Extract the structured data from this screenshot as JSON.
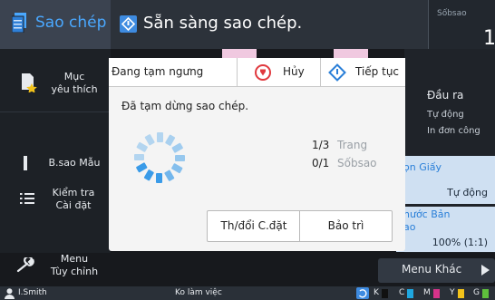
{
  "header": {
    "app_label": "Sao chép",
    "status": "Sẵn sàng sao chép.",
    "copies_caption": "Sốbsao",
    "copies_value": "1"
  },
  "menu": {
    "items": [
      {
        "label": "Mục\nyêu thích",
        "icon": "favorite-doc-icon"
      },
      {
        "label": "B.sao Mẫu",
        "icon": "sample-copy-icon"
      },
      {
        "label": "Kiểm tra\nCài đặt",
        "icon": "list-icon"
      },
      {
        "label": "Menu\nTùy chỉnh",
        "icon": "wrench-icon"
      }
    ]
  },
  "right_panel": {
    "title": "Đầu ra",
    "sub1": "Tự động",
    "sub2": "In đơn công",
    "paper_title": "ọn Giấy",
    "paper_value": "Tự động",
    "size_title": "hước Bản\nao",
    "size_value": "100% (1:1)"
  },
  "menu_khac": "Menu Khác",
  "status_bar": {
    "user": "I.Smith",
    "state": "Ko làm việc",
    "inks": [
      "K",
      "C",
      "M",
      "Y",
      "G"
    ]
  },
  "dialog": {
    "title": "Đang tạm ngưng",
    "cancel_label": "Hủy",
    "resume_label": "Tiếp tục",
    "message": "Đã tạm dừng sao chép.",
    "page_count": "1/3",
    "page_label": "Trang",
    "copy_count": "0/1",
    "copy_label": "Sốbsao",
    "change_label": "Th/đổi C.đặt",
    "maintenance_label": "Bảo trì"
  },
  "colors": {
    "accent": "#2a7fd8",
    "spinner": "#3a9be8",
    "cancel": "#e0393e",
    "ink_c": "#1fa7e0",
    "ink_m": "#d6338a",
    "ink_y": "#f2c21a",
    "ink_g": "#5fbf3c"
  }
}
